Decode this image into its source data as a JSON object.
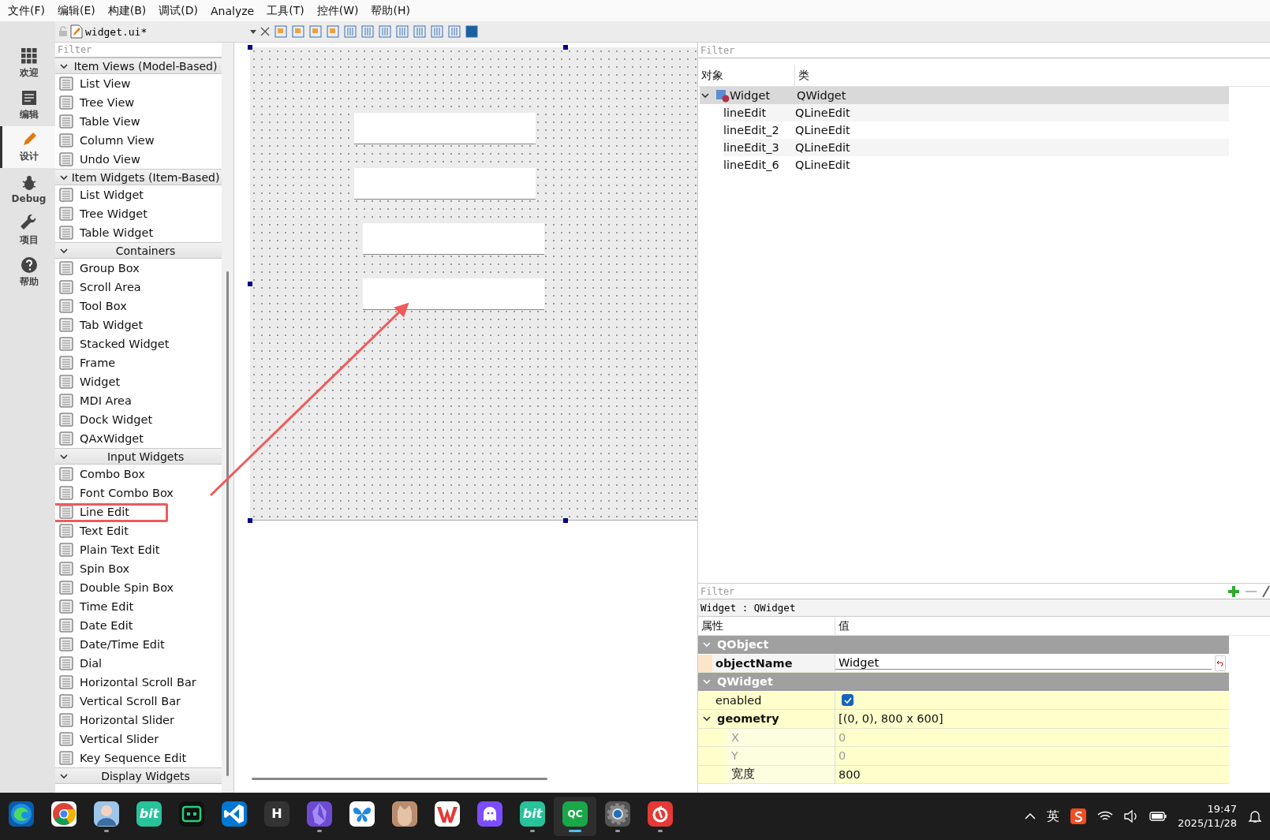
{
  "menu": [
    {
      "label": "文件(F)"
    },
    {
      "label": "编辑(E)"
    },
    {
      "label": "构建(B)"
    },
    {
      "label": "调试(D)"
    },
    {
      "label": "Analyze"
    },
    {
      "label": "工具(T)"
    },
    {
      "label": "控件(W)"
    },
    {
      "label": "帮助(H)"
    }
  ],
  "toolbar": {
    "file": "widget.ui*"
  },
  "modes": [
    {
      "label": "欢迎",
      "selected": false
    },
    {
      "label": "编辑",
      "selected": false
    },
    {
      "label": "设计",
      "selected": true
    },
    {
      "label": "Debug",
      "selected": false
    },
    {
      "label": "项目",
      "selected": false
    },
    {
      "label": "帮助",
      "selected": false
    }
  ],
  "widget_box": {
    "filter_placeholder": "Filter",
    "sections": [
      {
        "title": "Item Views (Model-Based)",
        "expanded": true,
        "items": [
          {
            "label": "List View",
            "annotated": false
          },
          {
            "label": "Tree View",
            "annotated": false
          },
          {
            "label": "Table View",
            "annotated": false
          },
          {
            "label": "Column View",
            "annotated": false
          },
          {
            "label": "Undo View",
            "annotated": false
          }
        ]
      },
      {
        "title": "Item Widgets (Item-Based)",
        "expanded": true,
        "items": [
          {
            "label": "List Widget",
            "annotated": false
          },
          {
            "label": "Tree Widget",
            "annotated": false
          },
          {
            "label": "Table Widget",
            "annotated": false
          }
        ]
      },
      {
        "title": "Containers",
        "expanded": true,
        "items": [
          {
            "label": "Group Box",
            "annotated": false
          },
          {
            "label": "Scroll Area",
            "annotated": false
          },
          {
            "label": "Tool Box",
            "annotated": false
          },
          {
            "label": "Tab Widget",
            "annotated": false
          },
          {
            "label": "Stacked Widget",
            "annotated": false
          },
          {
            "label": "Frame",
            "annotated": false
          },
          {
            "label": "Widget",
            "annotated": false
          },
          {
            "label": "MDI Area",
            "annotated": false
          },
          {
            "label": "Dock Widget",
            "annotated": false
          },
          {
            "label": "QAxWidget",
            "annotated": false
          }
        ]
      },
      {
        "title": "Input Widgets",
        "expanded": true,
        "items": [
          {
            "label": "Combo Box",
            "annotated": false
          },
          {
            "label": "Font Combo Box",
            "annotated": false
          },
          {
            "label": "Line Edit",
            "annotated": true
          },
          {
            "label": "Text Edit",
            "annotated": false
          },
          {
            "label": "Plain Text Edit",
            "annotated": false
          },
          {
            "label": "Spin Box",
            "annotated": false
          },
          {
            "label": "Double Spin Box",
            "annotated": false
          },
          {
            "label": "Time Edit",
            "annotated": false
          },
          {
            "label": "Date Edit",
            "annotated": false
          },
          {
            "label": "Date/Time Edit",
            "annotated": false
          },
          {
            "label": "Dial",
            "annotated": false
          },
          {
            "label": "Horizontal Scroll Bar",
            "annotated": false
          },
          {
            "label": "Vertical Scroll Bar",
            "annotated": false
          },
          {
            "label": "Horizontal Slider",
            "annotated": false
          },
          {
            "label": "Vertical Slider",
            "annotated": false
          },
          {
            "label": "Key Sequence Edit",
            "annotated": false
          }
        ]
      },
      {
        "title": "Display Widgets",
        "expanded": true
      }
    ]
  },
  "object_inspector": {
    "filter_placeholder": "Filter",
    "columns": [
      "对象",
      "类"
    ],
    "objects": [
      {
        "name": "Widget",
        "class": "QWidget",
        "selected": true,
        "expanded": true,
        "children": [
          {
            "name": "lineEdit",
            "class": "QLineEdit",
            "selected": false
          },
          {
            "name": "lineEdit_2",
            "class": "QLineEdit",
            "selected": false
          },
          {
            "name": "lineEdit_3",
            "class": "QLineEdit",
            "selected": false
          },
          {
            "name": "lineEdit_6",
            "class": "QLineEdit",
            "selected": false
          }
        ]
      }
    ]
  },
  "property_editor": {
    "filter_placeholder": "Filter",
    "caption": "Widget : QWidget",
    "columns": [
      "属性",
      "值"
    ],
    "groups": [
      {
        "name": "QObject",
        "expanded": true,
        "color": "#fde5c8",
        "properties": [
          {
            "name": "objectName",
            "kind": "field",
            "value": "Widget",
            "modified": true
          }
        ]
      },
      {
        "name": "QWidget",
        "expanded": true,
        "color": "#ffffcc",
        "properties": [
          {
            "name": "enabled",
            "kind": "check",
            "checked": true,
            "modified": false
          },
          {
            "name": "geometry",
            "kind": "text",
            "value": "[(0, 0), 800 x 600]",
            "modified": true,
            "expanded": true,
            "children": [
              {
                "name": "X",
                "value": "0",
                "dimmed": true
              },
              {
                "name": "Y",
                "value": "0",
                "dimmed": true
              },
              {
                "name": "宽度",
                "value": "800",
                "dimmed": false
              }
            ]
          }
        ]
      }
    ]
  },
  "taskbar": {
    "apps": [
      {
        "running": false,
        "active": false
      },
      {
        "running": false,
        "active": false
      },
      {
        "running": true,
        "active": false
      },
      {
        "glyph": "bit",
        "running": false,
        "active": false
      },
      {
        "running": false,
        "active": false
      },
      {
        "running": false,
        "active": false
      },
      {
        "glyph": "H",
        "running": false,
        "active": false
      },
      {
        "running": true,
        "active": false
      },
      {
        "running": false,
        "active": false
      },
      {
        "running": false,
        "active": false
      },
      {
        "running": false,
        "active": false
      },
      {
        "running": false,
        "active": false
      },
      {
        "glyph": "bit",
        "running": true,
        "active": false
      },
      {
        "glyph": "QC",
        "running": true,
        "active": true
      },
      {
        "running": true,
        "active": false
      },
      {
        "running": true,
        "active": false
      }
    ],
    "input_method": "英",
    "time": "19:47",
    "date": "2025/11/28"
  }
}
